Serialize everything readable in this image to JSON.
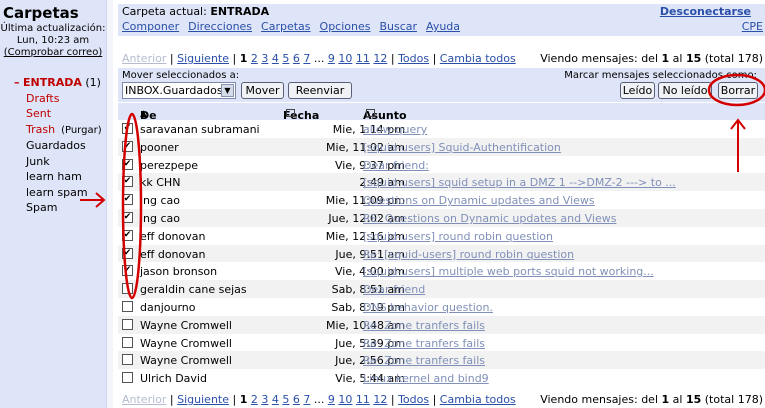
{
  "sidebar": {
    "title": "Carpetas",
    "last_update_label": "Última actualización:",
    "last_update_time": "Lun, 10:23 am",
    "check_mail": "(Comprobar correo)",
    "inbox_label": "ENTRADA",
    "inbox_count": "(1)",
    "items": [
      "Drafts",
      "Sent",
      "Trash",
      "Guardados",
      "Junk",
      "learn ham",
      "learn spam",
      "Spam"
    ],
    "purge": "(Purgar)"
  },
  "header": {
    "current_folder_label": "Carpeta actual:",
    "current_folder": "ENTRADA",
    "disconnect": "Desconectarse",
    "menu": [
      "Componer",
      "Direcciones",
      "Carpetas",
      "Opciones",
      "Buscar",
      "Ayuda"
    ],
    "cpe": "CPE"
  },
  "pager": {
    "prev": "Anterior",
    "next": "Siguiente",
    "current": "1",
    "pages": [
      "2",
      "3",
      "4",
      "5",
      "6",
      "7",
      "...",
      "9",
      "10",
      "11",
      "12"
    ],
    "all": "Todos",
    "toggle": "Cambia todos",
    "viewing_prefix": "Viendo mensajes: del",
    "range_from": "1",
    "range_to_label": "al",
    "range_to": "15",
    "total": "(total 178)"
  },
  "toolbar": {
    "move_label": "Mover seleccionados a:",
    "folder_select": "INBOX.Guardados",
    "move_button": "Mover",
    "forward_button": "Reenviar",
    "mark_label": "Marcar mensajes seleccionados como:",
    "read_button": "Leído",
    "unread_button": "No leído",
    "delete_button": "Borrar"
  },
  "table": {
    "col_from": "De",
    "col_date": "Fecha",
    "col_subject": "Asunto",
    "rows": [
      {
        "from": "saravanan subramani",
        "date": "Mie, 1:14 pm",
        "subject": "allow-query",
        "checked": true
      },
      {
        "from": "pooner",
        "date": "Mie, 11:02 am",
        "subject": "[squid-users] Squid-Authentification",
        "checked": true
      },
      {
        "from": "perezpepe",
        "date": "Vie, 9:37 pm",
        "subject": "Dear friend:",
        "checked": true
      },
      {
        "from": "kk CHN",
        "date": "2:49 am",
        "subject": "[squid-users] squid setup in a DMZ 1 -->DMZ-2 ---> to ...",
        "checked": true
      },
      {
        "from": "ing cao",
        "date": "Mie, 11:09 pm",
        "subject": "Questions on Dynamic updates and Views",
        "checked": true
      },
      {
        "from": "ing cao",
        "date": "Jue, 12:02 am",
        "subject": "RE: Questions on Dynamic updates and Views",
        "checked": true
      },
      {
        "from": "eff donovan",
        "date": "Mie, 12:16 pm",
        "subject": "[squid-users] round robin question",
        "checked": true
      },
      {
        "from": "eff donovan",
        "date": "Jue, 9:51 am",
        "subject": "Re: [squid-users] round robin question",
        "checked": true
      },
      {
        "from": "jason bronson",
        "date": "Vie, 4:00 pm",
        "subject": "[squid-users] multiple web ports squid not working...",
        "checked": true
      },
      {
        "from": "geraldin cane sejas",
        "date": "Sab, 8:51 am",
        "subject": "Dear friend",
        "checked": false
      },
      {
        "from": "danjourno",
        "date": "Sab, 8:19 pm",
        "subject": "DNS behavior question.",
        "checked": false
      },
      {
        "from": "Wayne Cromwell",
        "date": "Mie, 10:48 am",
        "subject": "Re: Zone tranfers fails",
        "checked": false
      },
      {
        "from": "Wayne Cromwell",
        "date": "Jue, 5:39 pm",
        "subject": "Re: Zone tranfers fails",
        "checked": false
      },
      {
        "from": "Wayne Cromwell",
        "date": "Jue, 2:56 pm",
        "subject": "Re: Zone tranfers fails",
        "checked": false
      },
      {
        "from": "Ulrich David",
        "date": "Vie, 5:44 am",
        "subject": "Linux kernel and bind9",
        "checked": false
      }
    ]
  },
  "colors": {
    "sidebar_bg": "#dee5f8",
    "link": "#2a4fa8",
    "inbox_red": "#c00000",
    "annotation_red": "#d40000"
  }
}
